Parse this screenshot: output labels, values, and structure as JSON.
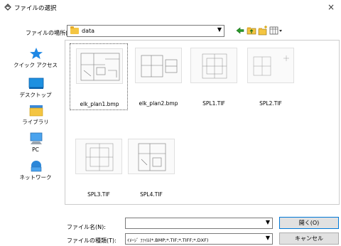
{
  "window": {
    "title": "ファイルの選択",
    "close_label": "×"
  },
  "location": {
    "label": "ファイルの場所(I):",
    "value": "data",
    "dropdown_icon": "chevron-down-icon"
  },
  "toolbar": {
    "back_icon": "back-arrow-icon",
    "up_icon": "up-folder-icon",
    "new_folder_icon": "new-folder-icon",
    "view_icon": "view-menu-icon"
  },
  "places": [
    {
      "label": "クイック アクセス",
      "icon": "star-icon"
    },
    {
      "label": "デスクトップ",
      "icon": "desktop-icon"
    },
    {
      "label": "ライブラリ",
      "icon": "library-icon"
    },
    {
      "label": "PC",
      "icon": "pc-icon"
    },
    {
      "label": "ネットワーク",
      "icon": "network-icon"
    }
  ],
  "files": [
    {
      "name": "elk_plan1.bmp",
      "selected": true
    },
    {
      "name": "elk_plan2.bmp",
      "selected": false
    },
    {
      "name": "SPL1.TIF",
      "selected": false
    },
    {
      "name": "SPL2.TIF",
      "selected": false
    },
    {
      "name": "SPL3.TIF",
      "selected": false
    },
    {
      "name": "SPL4.TIF",
      "selected": false
    }
  ],
  "filename": {
    "label": "ファイル名(N):",
    "value": ""
  },
  "filetype": {
    "label": "ファイルの種類(T):",
    "value": "ｲﾒｰｼﾞ ﾌｧｲﾙ(*.BMP;*.TIF;*.TIFF;*.DXF)"
  },
  "buttons": {
    "open": "開く(O)",
    "cancel": "キャンセル"
  }
}
